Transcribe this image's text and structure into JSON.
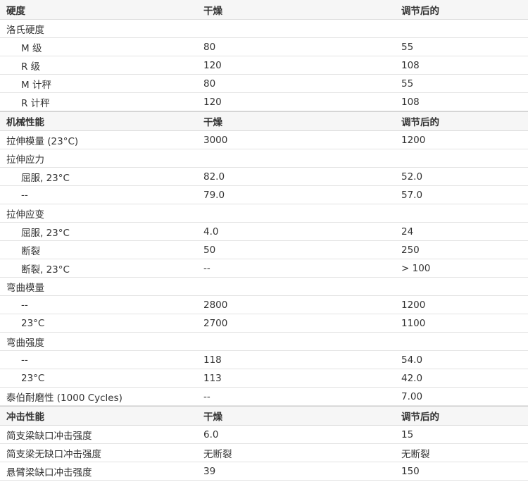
{
  "sections": [
    {
      "header": [
        "硬度",
        "干燥",
        "调节后的"
      ],
      "rows": [
        {
          "label": "洛氏硬度",
          "dry": "",
          "cond": "",
          "sub": false
        },
        {
          "label": "M 级",
          "dry": "80",
          "cond": "55",
          "sub": true
        },
        {
          "label": "R 级",
          "dry": "120",
          "cond": "108",
          "sub": true
        },
        {
          "label": "M 计秤",
          "dry": "80",
          "cond": "55",
          "sub": true
        },
        {
          "label": "R 计秤",
          "dry": "120",
          "cond": "108",
          "sub": true
        }
      ]
    },
    {
      "header": [
        "机械性能",
        "干燥",
        "调节后的"
      ],
      "rows": [
        {
          "label": "拉伸模量 (23°C)",
          "dry": "3000",
          "cond": "1200",
          "sub": false
        },
        {
          "label": "拉伸应力",
          "dry": "",
          "cond": "",
          "sub": false
        },
        {
          "label": "屈服, 23°C",
          "dry": "82.0",
          "cond": "52.0",
          "sub": true
        },
        {
          "label": "--",
          "dry": "79.0",
          "cond": "57.0",
          "sub": true
        },
        {
          "label": "拉伸应变",
          "dry": "",
          "cond": "",
          "sub": false
        },
        {
          "label": "屈服, 23°C",
          "dry": "4.0",
          "cond": "24",
          "sub": true
        },
        {
          "label": "断裂",
          "dry": "50",
          "cond": "250",
          "sub": true
        },
        {
          "label": "断裂, 23°C",
          "dry": "--",
          "cond": "> 100",
          "sub": true
        },
        {
          "label": "弯曲模量",
          "dry": "",
          "cond": "",
          "sub": false
        },
        {
          "label": "--",
          "dry": "2800",
          "cond": "1200",
          "sub": true
        },
        {
          "label": "23°C",
          "dry": "2700",
          "cond": "1100",
          "sub": true
        },
        {
          "label": "弯曲强度",
          "dry": "",
          "cond": "",
          "sub": false
        },
        {
          "label": "--",
          "dry": "118",
          "cond": "54.0",
          "sub": true
        },
        {
          "label": "23°C",
          "dry": "113",
          "cond": "42.0",
          "sub": true
        },
        {
          "label": "泰伯耐磨性 (1000 Cycles)",
          "dry": "--",
          "cond": "7.00",
          "sub": false
        }
      ]
    },
    {
      "header": [
        "冲击性能",
        "干燥",
        "调节后的"
      ],
      "rows": [
        {
          "label": "简支梁缺口冲击强度",
          "dry": "6.0",
          "cond": "15",
          "sub": false
        },
        {
          "label": "简支梁无缺口冲击强度",
          "dry": "无断裂",
          "cond": "无断裂",
          "sub": false
        },
        {
          "label": "悬臂梁缺口冲击强度",
          "dry": "39",
          "cond": "150",
          "sub": false
        }
      ]
    }
  ]
}
